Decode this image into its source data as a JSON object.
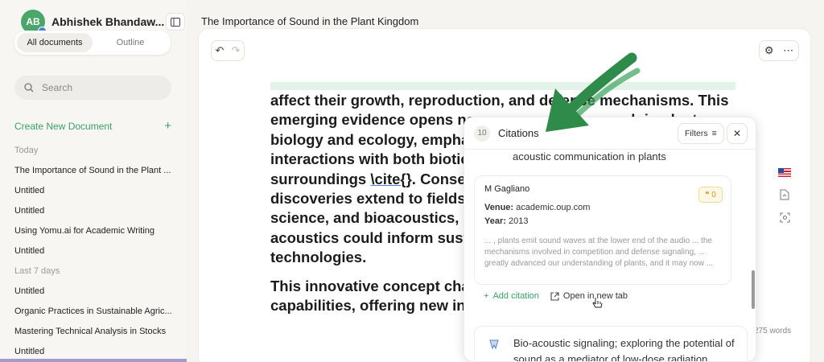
{
  "sidebar": {
    "user_initials": "AB",
    "user_name": "Abhishek Bhandaw...",
    "tabs": [
      {
        "label": "All documents",
        "active": true
      },
      {
        "label": "Outline",
        "active": false
      }
    ],
    "search_placeholder": "Search",
    "create_label": "Create New Document",
    "sections": [
      {
        "label": "Today",
        "items": [
          "The Importance of Sound in the Plant ...",
          "Untitled",
          "Untitled",
          "Using Yomu.ai for Academic Writing",
          "Untitled"
        ]
      },
      {
        "label": "Last 7 days",
        "items": [
          "Untitled",
          "Organic Practices in Sustainable Agric...",
          "Mastering Technical Analysis in Stocks",
          "Untitled"
        ]
      }
    ]
  },
  "header": {
    "doc_title": "The Importance of Sound in the Plant Kingdom"
  },
  "editor": {
    "para1": [
      "affect their growth, reproduction, and defense mechanisms. This",
      "emerging evidence opens new avenues for research in plant",
      "biology and ecology, emphasizing the importance of sound",
      "interactions with both biotic and abiotic",
      "surroundings ",
      "\\cite{}",
      ". Conse",
      "discoveries extend to fields",
      "science, and bioacoustics,",
      "acoustics could inform sust",
      "technologies."
    ],
    "para2": [
      "This innovative concept cha",
      "capabilities, offering new in"
    ],
    "word_count": "275 words"
  },
  "citations": {
    "count": "10",
    "title": "Citations",
    "filters_label": "Filters",
    "top_text": "acoustic communication in plants",
    "card": {
      "author": "M Gagliano",
      "quote_count": "0",
      "venue_label": "Venue:",
      "venue": "academic.oup.com",
      "year_label": "Year:",
      "year": "2013",
      "snippet": "... , plants emit sound waves at the lower end of the audio ... the mechanisms involved in competition and defense signaling, ... greatly advanced our understanding of plants, and it may now ..."
    },
    "add_label": "Add citation",
    "open_label": "Open in new tab",
    "next_title": "Bio-acoustic signaling; exploring the potential of sound as a mediator of low-dose radiation"
  },
  "colors": {
    "accent": "#3aa068",
    "arrow": "#2e8b4a"
  }
}
